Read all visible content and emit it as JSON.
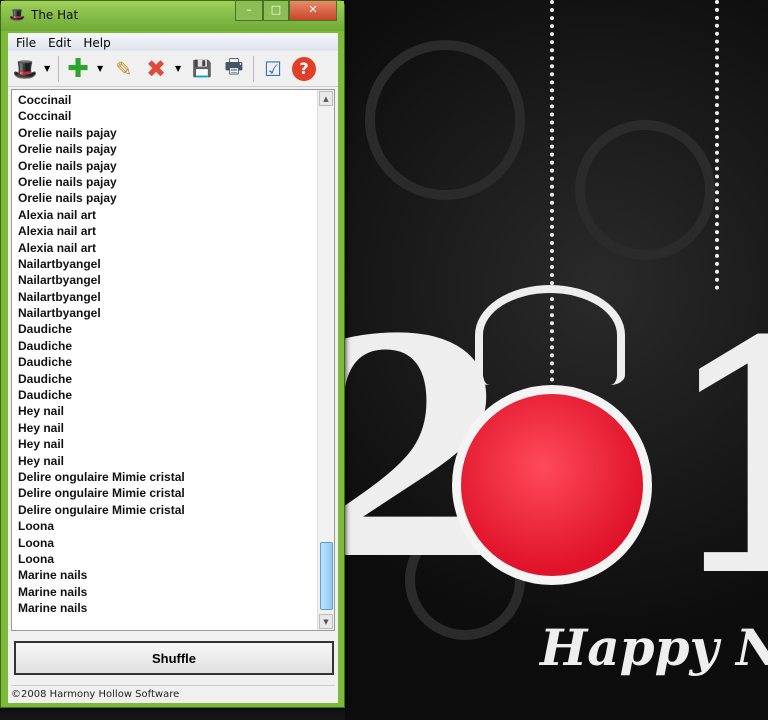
{
  "window": {
    "title": "The Hat",
    "minimize": "–",
    "maximize": "□",
    "close": "✕"
  },
  "menu": [
    "File",
    "Edit",
    "Help"
  ],
  "toolbar": [
    {
      "icon": "hat-icon",
      "glyph": "🎩"
    },
    {
      "icon": "add-icon",
      "glyph": "✚"
    },
    {
      "icon": "edit-icon",
      "glyph": "✎"
    },
    {
      "icon": "delete-icon",
      "glyph": "✖"
    },
    {
      "icon": "save-icon",
      "glyph": "💾"
    },
    {
      "icon": "print-icon",
      "glyph": "🖶"
    },
    {
      "icon": "checklist-icon",
      "glyph": "☑"
    },
    {
      "icon": "help-icon",
      "glyph": "?"
    }
  ],
  "list": [
    "Coccinail",
    "Coccinail",
    "Orelie nails pajay",
    "Orelie nails pajay",
    "Orelie nails pajay",
    "Orelie nails pajay",
    "Orelie nails pajay",
    "Alexia nail art",
    "Alexia nail art",
    "Alexia nail art",
    "Nailartbyangel",
    "Nailartbyangel",
    "Nailartbyangel",
    "Nailartbyangel",
    "Daudiche",
    "Daudiche",
    "Daudiche",
    "Daudiche",
    "Daudiche",
    "Hey nail",
    "Hey nail",
    "Hey nail",
    "Hey nail",
    "Delire ongulaire Mimie cristal",
    "Delire ongulaire Mimie cristal",
    "Delire ongulaire Mimie cristal",
    "Loona",
    "Loona",
    "Loona",
    "Marine nails",
    "Marine nails",
    "Marine nails"
  ],
  "shuffle_label": "Shuffle",
  "status": "©2008 Harmony Hollow Software",
  "wallpaper": {
    "greeting": "Happy N",
    "two": "2",
    "one": "1"
  }
}
